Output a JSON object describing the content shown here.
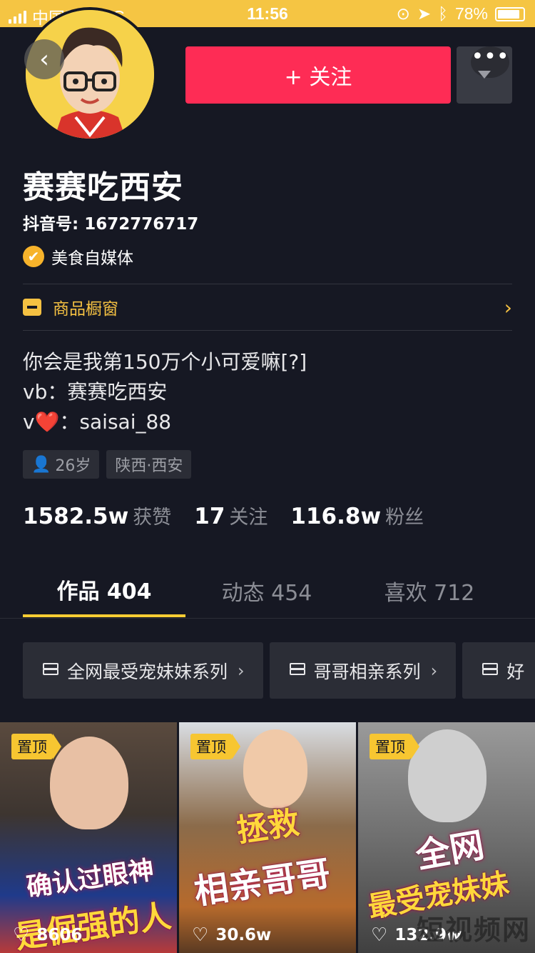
{
  "status_bar": {
    "carrier": "中国移动",
    "network": "4G",
    "time": "11:56",
    "battery": "78%"
  },
  "header": {
    "follow_label": "+ 关注",
    "more_label": "•••"
  },
  "profile": {
    "name": "赛赛吃西安",
    "douyin_id": "抖音号: 1672776717",
    "verify_label": "美食自媒体",
    "shop_label": "商品橱窗",
    "bio": [
      "你会是我第150万个小可爱嘛[?]",
      "vb：赛赛吃西安",
      "v❤️：saisai_88"
    ],
    "tags": {
      "age": "26岁",
      "location": "陕西·西安"
    }
  },
  "stats": [
    {
      "value": "1582.5w",
      "label": "获赞"
    },
    {
      "value": "17",
      "label": "关注"
    },
    {
      "value": "116.8w",
      "label": "粉丝"
    }
  ],
  "tabs": [
    {
      "label": "作品 404"
    },
    {
      "label": "动态 454"
    },
    {
      "label": "喜欢 712"
    }
  ],
  "collections": [
    {
      "label": "全网最受宠妹妹系列"
    },
    {
      "label": "哥哥相亲系列"
    },
    {
      "label": "好"
    }
  ],
  "videos": [
    {
      "pin": "置顶",
      "likes": "8606",
      "caption_top": "确认过眼神",
      "caption_bottom": "是倔强的人"
    },
    {
      "pin": "置顶",
      "likes": "30.6w",
      "caption_top": "拯救",
      "caption_bottom": "相亲哥哥"
    },
    {
      "pin": "置顶",
      "likes": "132.9w",
      "caption_top": "全网",
      "caption_bottom": "最受宠妹妹"
    }
  ],
  "watermark": "短视频网"
}
